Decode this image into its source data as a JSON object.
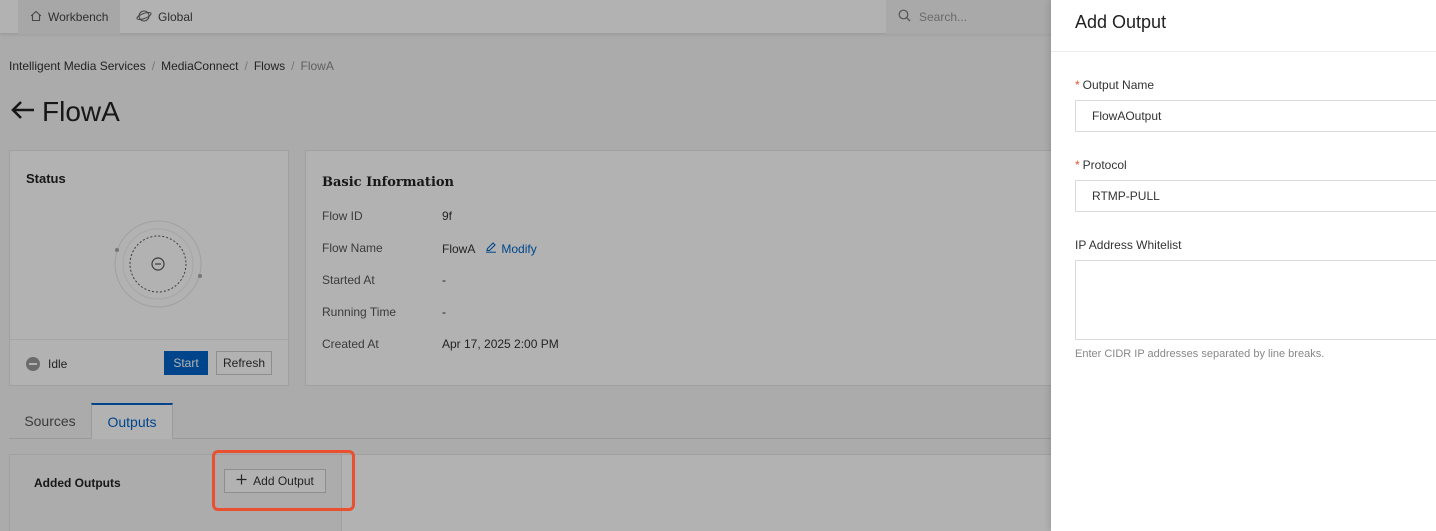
{
  "topbar": {
    "workbench_label": "Workbench",
    "global_label": "Global",
    "search_placeholder": "Search..."
  },
  "breadcrumb": [
    "Intelligent Media Services",
    "MediaConnect",
    "Flows",
    "FlowA"
  ],
  "page": {
    "title": "FlowA"
  },
  "status_card": {
    "title": "Status",
    "state": "Idle",
    "start_label": "Start",
    "refresh_label": "Refresh"
  },
  "basic_info": {
    "title": "Basic Information",
    "rows": [
      {
        "label": "Flow ID",
        "value": "9f"
      },
      {
        "label": "Flow Name",
        "value": "FlowA"
      },
      {
        "label": "Started At",
        "value": "-"
      },
      {
        "label": "Running Time",
        "value": "-"
      },
      {
        "label": "Created At",
        "value": "Apr 17, 2025 2:00 PM"
      }
    ],
    "modify_label": "Modify"
  },
  "tabs": [
    {
      "label": "Sources"
    },
    {
      "label": "Outputs"
    }
  ],
  "outputs": {
    "added_label": "Added Outputs",
    "add_button_label": "Add Output"
  },
  "drawer": {
    "title": "Add Output",
    "output_name": {
      "label": "Output Name",
      "value": "FlowAOutput"
    },
    "protocol": {
      "label": "Protocol",
      "value": "RTMP-PULL"
    },
    "whitelist": {
      "label": "IP Address Whitelist",
      "value": "",
      "help": "Enter CIDR IP addresses separated by line breaks."
    }
  },
  "colors": {
    "primary": "#0064c8",
    "highlight": "#e8502f",
    "required": "#e8502f"
  }
}
